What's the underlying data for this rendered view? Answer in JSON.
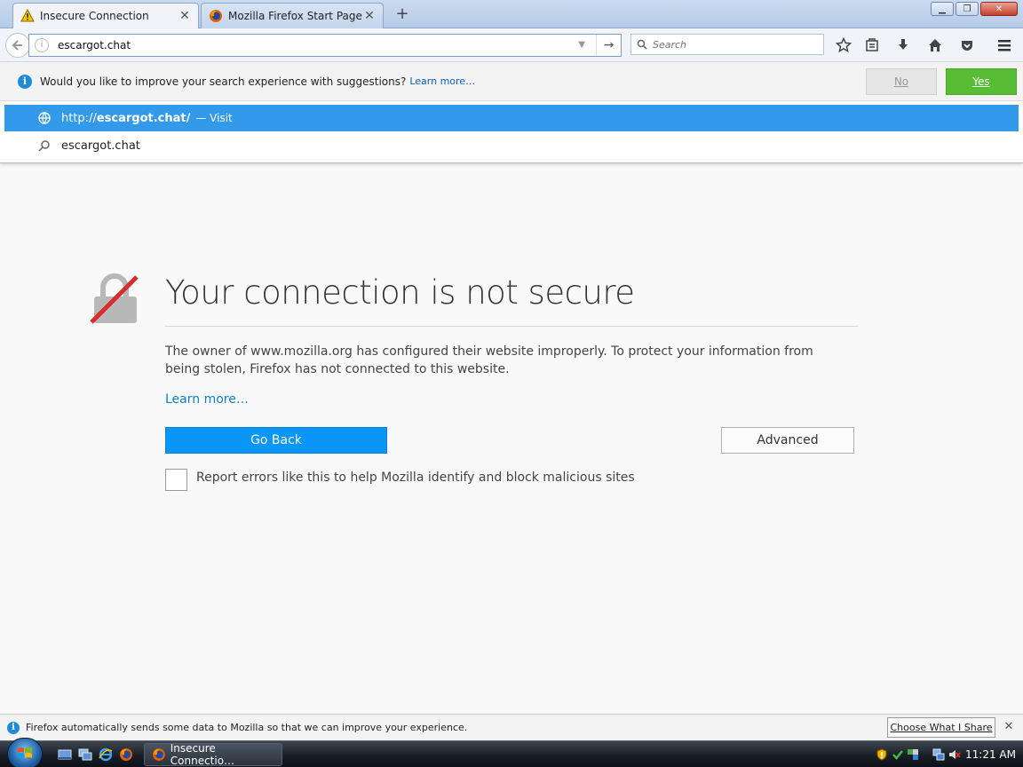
{
  "browser": {
    "tabs": [
      {
        "label": "Insecure Connection",
        "icon": "warning-icon",
        "active": true
      },
      {
        "label": "Mozilla Firefox Start Page",
        "icon": "firefox-icon",
        "active": false
      }
    ],
    "new_tab_glyph": "+",
    "url_value": "escargot.chat",
    "search_placeholder": "Search"
  },
  "suggestions_bar": {
    "message": "Would you like to improve your search experience with suggestions?",
    "learn_more": "Learn more…",
    "no_label": "No",
    "yes_label": "Yes"
  },
  "url_results": [
    {
      "prefix": "http://",
      "bold": "escargot.chat/",
      "action": "— Visit",
      "icon": "globe-icon",
      "selected": true
    },
    {
      "text": "escargot.chat",
      "icon": "search-icon",
      "selected": false
    }
  ],
  "error_page": {
    "title": "Your connection is not secure",
    "description": "The owner of www.mozilla.org has configured their website improperly. To protect your information from being stolen, Firefox has not connected to this website.",
    "learn_more": "Learn more…",
    "go_back_label": "Go Back",
    "advanced_label": "Advanced",
    "report_label": "Report errors like this to help Mozilla identify and block malicious sites",
    "report_checked": false
  },
  "data_notice": {
    "message": "Firefox automatically sends some data to Mozilla so that we can improve your experience.",
    "button_label": "Choose What I Share"
  },
  "taskbar": {
    "task_label": "Insecure Connectio…",
    "clock": "11:21 AM"
  },
  "colors": {
    "accent_blue": "#0996f8",
    "selected_row": "#3399ea",
    "yes_green": "#57bd35",
    "insecure_red": "#d92d2d"
  }
}
